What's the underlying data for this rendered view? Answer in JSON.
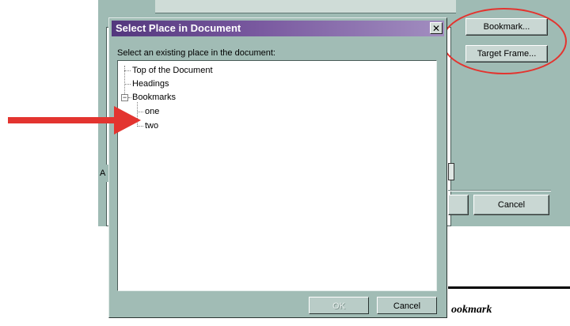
{
  "parent_dialog": {
    "bookmark_button": "Bookmark...",
    "target_frame_button": "Target Frame...",
    "cancel_button": "Cancel",
    "address_label": "A"
  },
  "select_dialog": {
    "title": "Select Place in Document",
    "close_glyph": "✕",
    "prompt": "Select an existing place in the document:",
    "tree": {
      "top_of_document": "Top of the Document",
      "headings": "Headings",
      "bookmarks": {
        "label": "Bookmarks",
        "expander": "−",
        "children": [
          "one",
          "two"
        ]
      }
    },
    "ok_button": "OK",
    "cancel_button": "Cancel"
  },
  "document": {
    "visible_text": "ookmark"
  },
  "colors": {
    "annotation_red": "#e3342f",
    "dialog_face": "#a1bcb5",
    "title_gradient_start": "#53377d"
  },
  "icons": [
    "close-icon",
    "tree-expander-icon",
    "red-arrow-icon",
    "highlight-ellipse"
  ]
}
